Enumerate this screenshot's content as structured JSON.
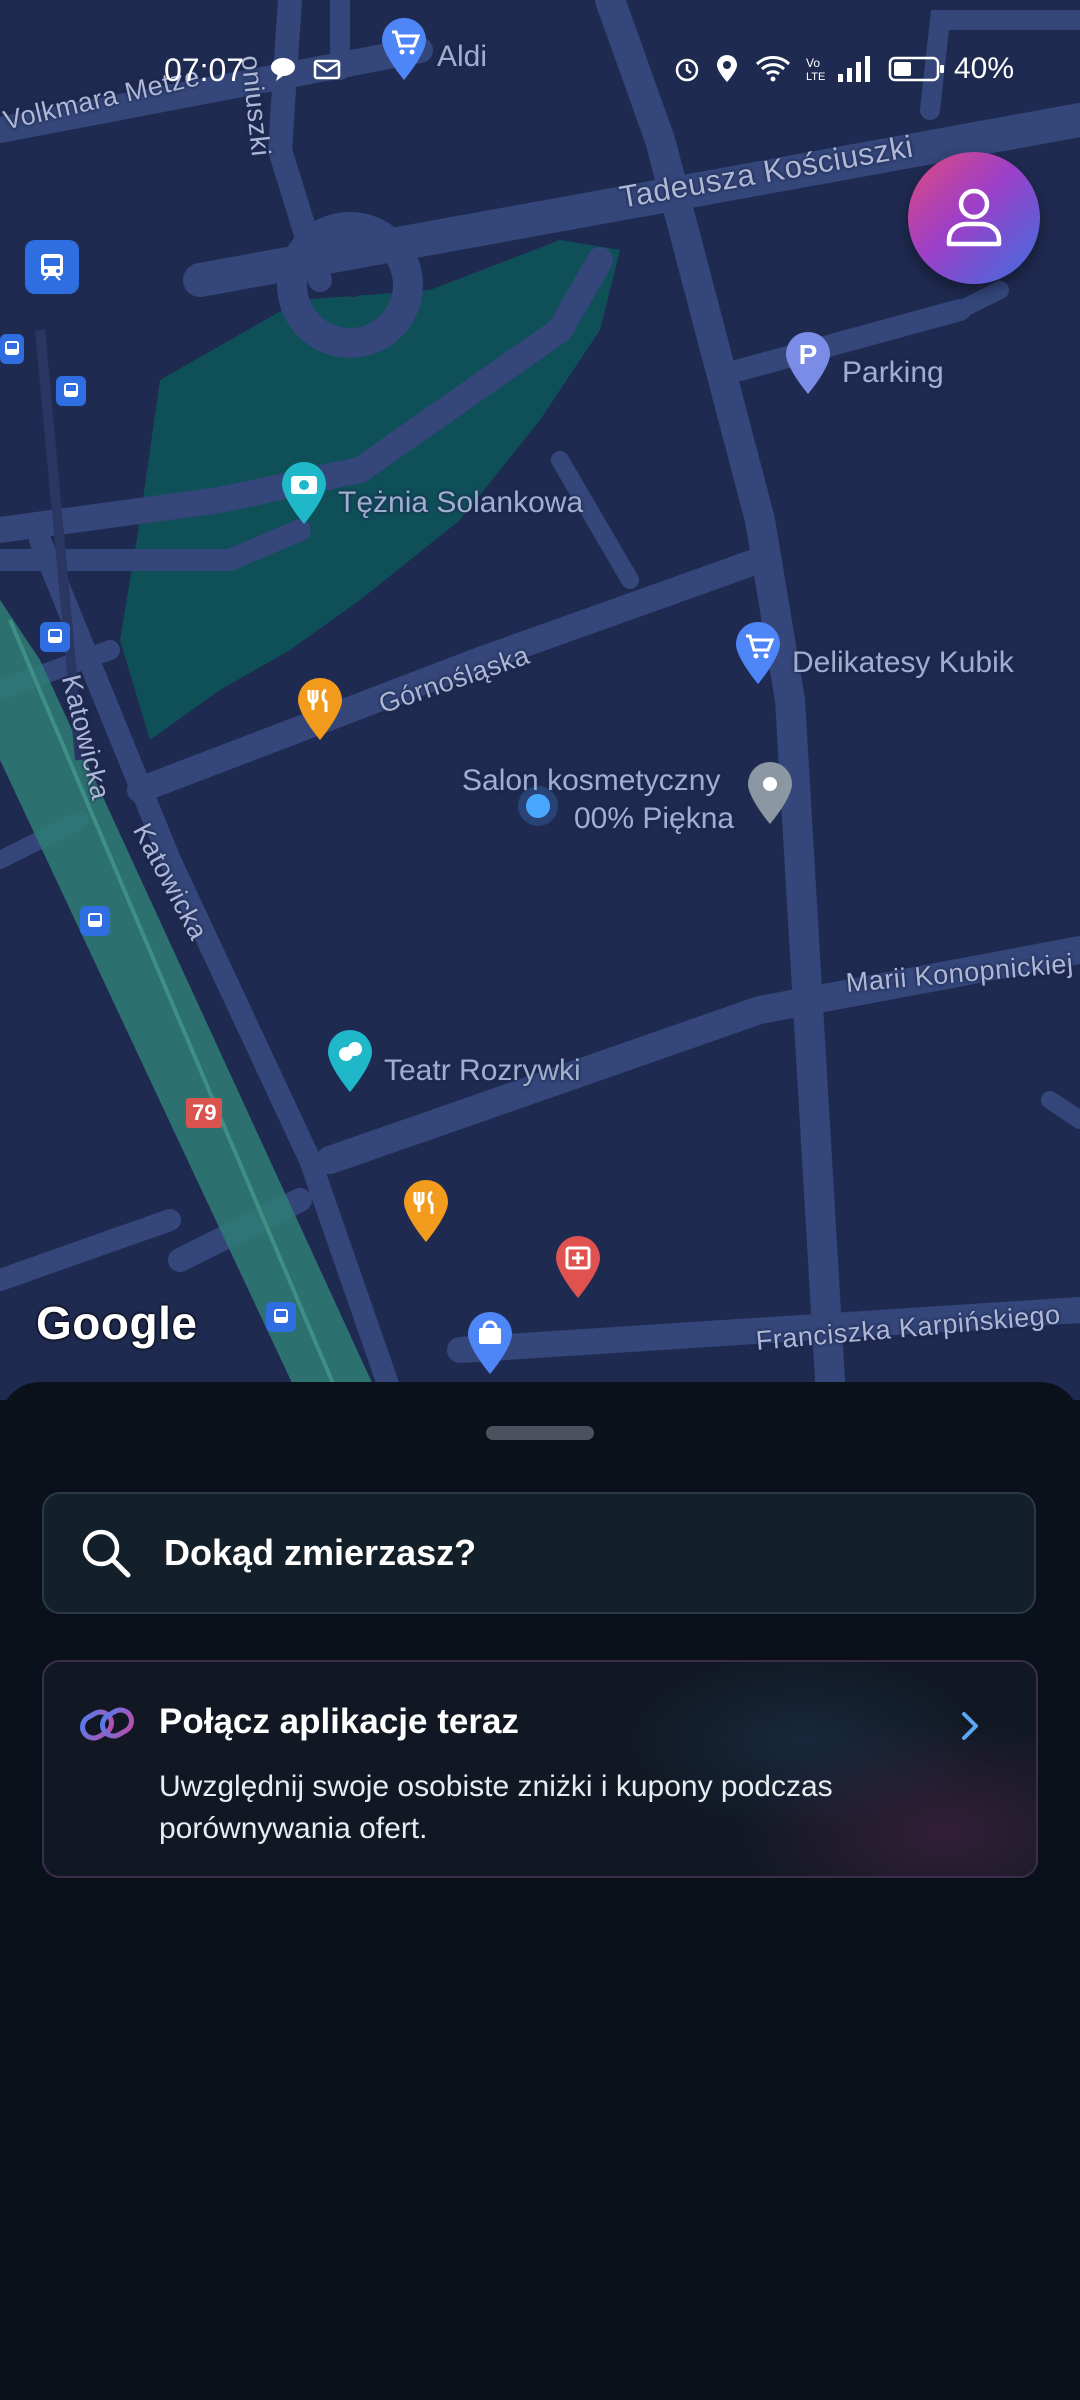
{
  "status_bar": {
    "time": "07:07",
    "battery_text": "40%",
    "icons": [
      "chat-bubble-icon",
      "mail-icon",
      "alarm-icon",
      "location-icon",
      "wifi-icon",
      "volte-icon",
      "signal-icon",
      "battery-icon"
    ]
  },
  "map": {
    "streets": [
      "Volkmara Metze",
      "Tadeusza Kościuszki",
      "Górnośląska",
      "Katowicka",
      "Katowicka",
      "Marii Konopnickiej",
      "Franciszka Karpińskiego",
      "oniuszki"
    ],
    "pois": [
      {
        "label": "Aldi",
        "type": "shopping-cart-icon",
        "color": "#4f86f7"
      },
      {
        "label": "Parking",
        "type": "parking-icon",
        "color": "#7b8ce6"
      },
      {
        "label": "Tężnia Solankowa",
        "type": "camera-icon",
        "color": "#1fb8c9"
      },
      {
        "label": "Delikatesy Kubik",
        "type": "shopping-cart-icon",
        "color": "#4f86f7"
      },
      {
        "label": "Salon kosmetyczny",
        "type": "pin-icon",
        "color": "#8b97a3"
      },
      {
        "label": "00% Piękna",
        "type": "pin-icon",
        "color": "#8b97a3"
      },
      {
        "label": "Teatr Rozrywki",
        "type": "theater-icon",
        "color": "#1fb8c9"
      },
      {
        "label": "",
        "type": "restaurant-icon",
        "color": "#f29b1d"
      },
      {
        "label": "",
        "type": "hospital-icon",
        "color": "#e0524f"
      },
      {
        "label": "",
        "type": "shopping-bag-icon",
        "color": "#4f86f7"
      }
    ],
    "route_number": "79",
    "google_logo": "Google",
    "water_color": "#0f4f58",
    "rail_color": "#2f7d76"
  },
  "profile": {
    "icon": "user-icon"
  },
  "sheet": {
    "search_placeholder": "Dokąd zmierzasz?",
    "promo": {
      "title": "Połącz aplikacje teraz",
      "text": "Uwzględnij swoje osobiste zniżki i kupony podczas porównywania ofert."
    }
  }
}
